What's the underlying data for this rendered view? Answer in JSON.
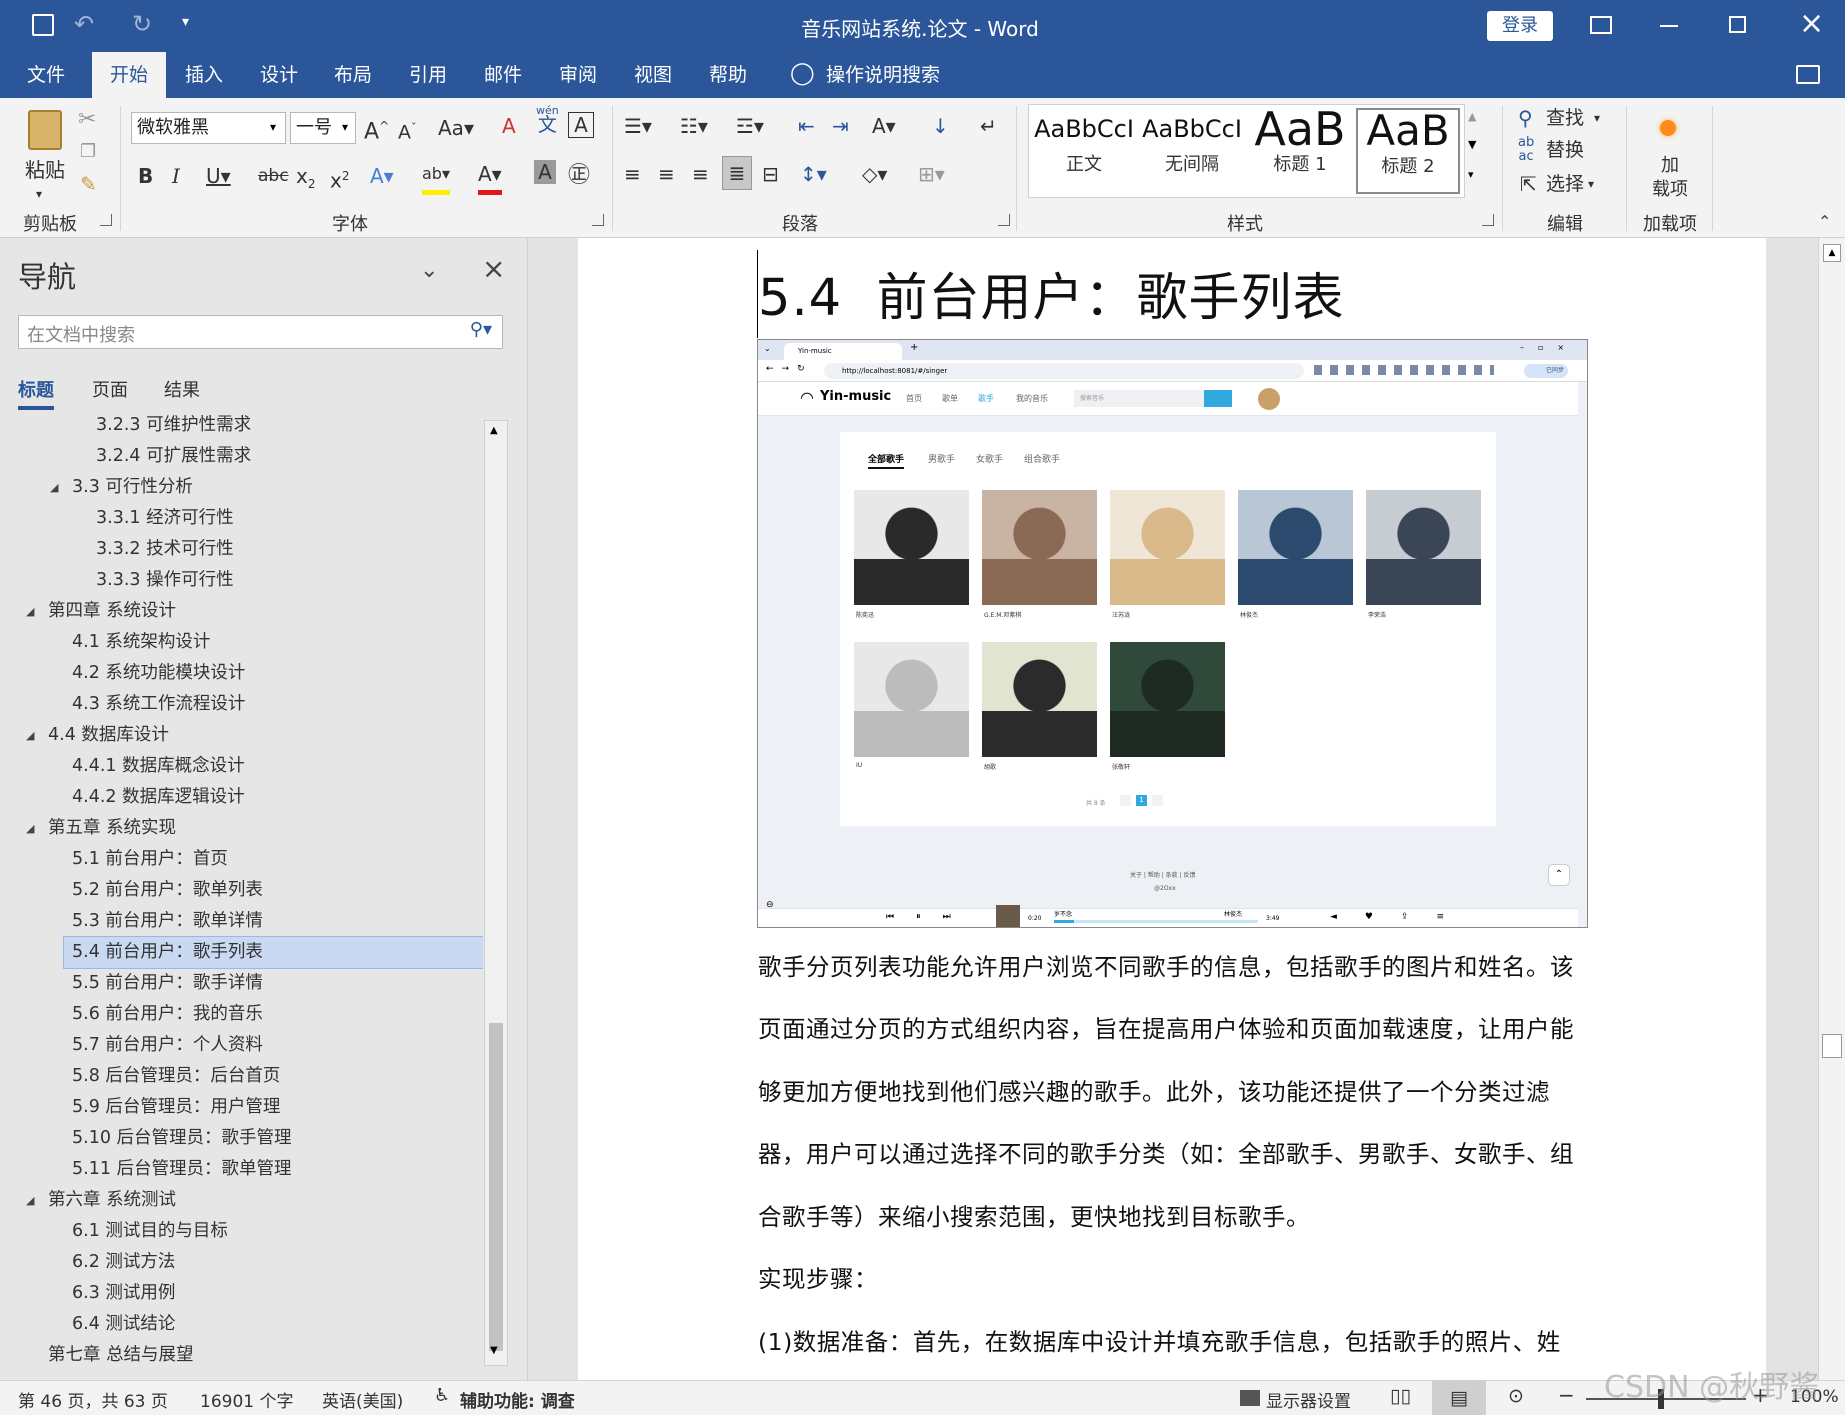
{
  "window": {
    "title": "音乐网站系统.论文 - Word",
    "login": "登录"
  },
  "tabs": [
    "文件",
    "开始",
    "插入",
    "设计",
    "布局",
    "引用",
    "邮件",
    "审阅",
    "视图",
    "帮助"
  ],
  "tell_me": "操作说明搜索",
  "ribbon": {
    "clipboard": {
      "paste": "粘贴",
      "label": "剪贴板"
    },
    "font": {
      "name": "微软雅黑",
      "size": "一号",
      "label": "字体",
      "wen": "wén",
      "wen_char": "文"
    },
    "paragraph": {
      "label": "段落"
    },
    "styles": {
      "label": "样式",
      "items": [
        {
          "preview": "AaBbCcI",
          "name": "正文"
        },
        {
          "preview": "AaBbCcI",
          "name": "无间隔"
        },
        {
          "preview": "AaB",
          "name": "标题 1"
        },
        {
          "preview": "AaB",
          "name": "标题 2"
        }
      ]
    },
    "editing": {
      "find": "查找",
      "replace": "替换",
      "select": "选择",
      "label": "编辑"
    },
    "addins": {
      "btn_line1": "加",
      "btn_line2": "载项",
      "label": "加载项"
    }
  },
  "nav": {
    "title": "导航",
    "search_placeholder": "在文档中搜索",
    "tabs": [
      "标题",
      "页面",
      "结果"
    ],
    "items": [
      {
        "text": "3.2.3 可维护性需求",
        "level": 3
      },
      {
        "text": "3.2.4 可扩展性需求",
        "level": 3
      },
      {
        "text": "3.3 可行性分析",
        "level": 2,
        "collapsible": true
      },
      {
        "text": "3.3.1 经济可行性",
        "level": 3
      },
      {
        "text": "3.3.2 技术可行性",
        "level": 3
      },
      {
        "text": "3.3.3 操作可行性",
        "level": 3
      },
      {
        "text": "第四章 系统设计",
        "level": 1,
        "collapsible": true
      },
      {
        "text": "4.1 系统架构设计",
        "level": 2
      },
      {
        "text": "4.2 系统功能模块设计",
        "level": 2
      },
      {
        "text": "4.3 系统工作流程设计",
        "level": 2
      },
      {
        "text": "4.4 数据库设计",
        "level": 1,
        "collapsible": true
      },
      {
        "text": "4.4.1 数据库概念设计",
        "level": 2
      },
      {
        "text": "4.4.2 数据库逻辑设计",
        "level": 2
      },
      {
        "text": "第五章 系统实现",
        "level": 1,
        "collapsible": true
      },
      {
        "text": "5.1 前台用户：首页",
        "level": 2
      },
      {
        "text": "5.2 前台用户：歌单列表",
        "level": 2
      },
      {
        "text": "5.3 前台用户：歌单详情",
        "level": 2
      },
      {
        "text": "5.4 前台用户：歌手列表",
        "level": 2,
        "selected": true
      },
      {
        "text": "5.5 前台用户：歌手详情",
        "level": 2
      },
      {
        "text": "5.6 前台用户：我的音乐",
        "level": 2
      },
      {
        "text": "5.7 前台用户：个人资料",
        "level": 2
      },
      {
        "text": "5.8 后台管理员：后台首页",
        "level": 2
      },
      {
        "text": "5.9 后台管理员：用户管理",
        "level": 2
      },
      {
        "text": "5.10 后台管理员：歌手管理",
        "level": 2
      },
      {
        "text": "5.11 后台管理员：歌单管理",
        "level": 2
      },
      {
        "text": "第六章 系统测试",
        "level": 1,
        "collapsible": true
      },
      {
        "text": "6.1 测试目的与目标",
        "level": 2
      },
      {
        "text": "6.2 测试方法",
        "level": 2
      },
      {
        "text": "6.3 测试用例",
        "level": 2
      },
      {
        "text": "6.4 测试结论",
        "level": 2
      },
      {
        "text": "第七章 总结与展望",
        "level": 1
      }
    ]
  },
  "doc": {
    "heading": "5.4  前台用户：歌手列表",
    "paragraphs": [
      "歌手分页列表功能允许用户浏览不同歌手的信息，包括歌手的图片和姓名。该",
      "页面通过分页的方式组织内容，旨在提高用户体验和页面加载速度，让用户能",
      "够更加方便地找到他们感兴趣的歌手。此外，该功能还提供了一个分类过滤",
      "器，用户可以通过选择不同的歌手分类（如：全部歌手、男歌手、女歌手、组",
      "合歌手等）来缩小搜索范围，更快地找到目标歌手。",
      "实现步骤：",
      "(1)数据准备：首先，在数据库中设计并填充歌手信息，包括歌手的照片、姓"
    ]
  },
  "embedded": {
    "tab_title": "Yin-music",
    "url": "http://localhost:8081/#/singer",
    "logo": "Yin-music",
    "nav": [
      "首页",
      "歌单",
      "歌手",
      "我的音乐"
    ],
    "search_placeholder": "搜索音乐",
    "categories": [
      "全部歌手",
      "男歌手",
      "女歌手",
      "组合歌手"
    ],
    "singers": [
      "陈奕迅",
      "G.E.M.邓紫棋",
      "汪苏泷",
      "林俊杰",
      "李荣浩",
      "IU",
      "胡歌",
      "张敬轩"
    ],
    "pager_total": "共 8 条",
    "pager_page": "1",
    "footer_links": "关于 | 帮助 | 条款 | 反馈",
    "footer_copy": "@2Oxx",
    "player": {
      "cur": "0:20",
      "song": "岁不念",
      "artist": "林俊杰",
      "dur": "3:49",
      "sync": "已同步"
    }
  },
  "status": {
    "page": "第 46 页，共 63 页",
    "words": "16901 个字",
    "lang": "英语(美国)",
    "access": "辅助功能: 调查",
    "display": "显示器设置",
    "zoom": "100%"
  },
  "watermark": "CSDN @秋野酱"
}
